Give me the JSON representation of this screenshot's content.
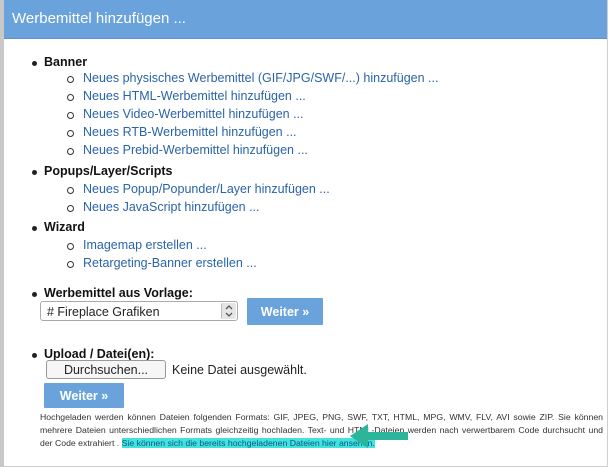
{
  "header": {
    "title": "Werbemittel hinzufügen ..."
  },
  "sections": {
    "banner": {
      "title": "Banner",
      "links": [
        "Neues physisches Werbemittel (GIF/JPG/SWF/...) hinzufügen ...",
        "Neues HTML-Werbemittel hinzufügen ...",
        "Neues Video-Werbemittel hinzufügen ...",
        "Neues RTB-Werbemittel hinzufügen ...",
        "Neues Prebid-Werbemittel hinzufügen ..."
      ]
    },
    "popups": {
      "title": "Popups/Layer/Scripts",
      "links": [
        "Neues Popup/Popunder/Layer hinzufügen ...",
        "Neues JavaScript hinzufügen ..."
      ]
    },
    "wizard": {
      "title": "Wizard",
      "links": [
        "Imagemap erstellen ...",
        "Retargeting-Banner erstellen ..."
      ]
    },
    "template": {
      "title": "Werbemittel aus Vorlage:",
      "selected": "# Fireplace Grafiken",
      "button": "Weiter »"
    },
    "upload": {
      "title": "Upload / Datei(en):",
      "browse_button": "Durchsuchen...",
      "file_status": "Keine Datei ausgewählt.",
      "button": "Weiter »",
      "info_text": "Hochgeladen werden können Dateien folgenden Formats: GIF, JPEG, PNG, SWF, TXT, HTML, MPG, WMV, FLV, AVI sowie ZIP. Sie können mehrere Dateien unterschiedlichen Formats gleichzeitig hochladen. Text- und HTML-Dateien werden nach verwertbarem Code durchsucht und der Code extrahiert .",
      "info_link": "Sie können sich die bereits hochgeladenen Dateien hier ansehen."
    }
  },
  "colors": {
    "header_bg": "#6aa3db",
    "link": "#2a64a8",
    "highlight": "#3fe4dc",
    "arrow": "#2bb59a"
  }
}
